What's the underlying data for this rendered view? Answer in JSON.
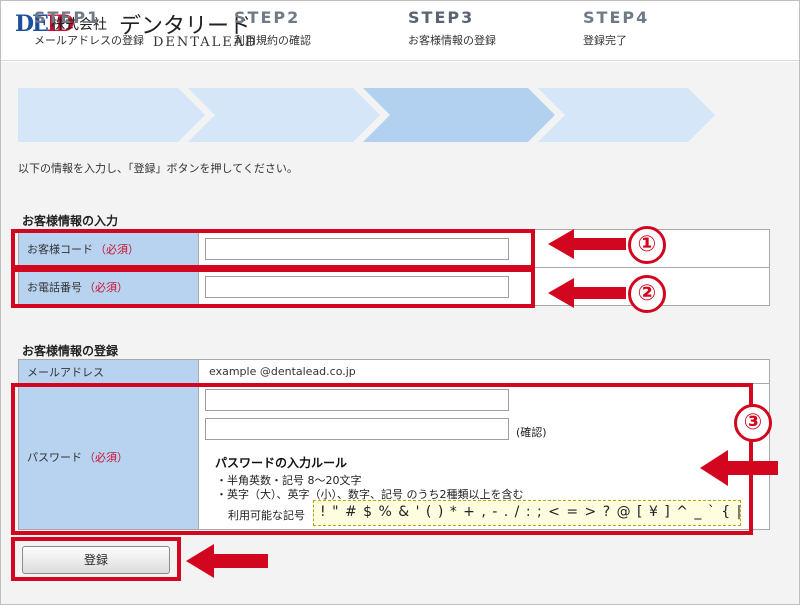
{
  "header": {
    "logo_mark_a": "DE",
    "logo_mark_b": "ID",
    "company_prefix": "株式会社",
    "company_name": "デンタリード",
    "company_en": "DENTALEAD"
  },
  "steps": [
    {
      "num": "STEP1",
      "label": "メールアドレスの登録",
      "state": "done"
    },
    {
      "num": "STEP2",
      "label": "利用規約の確認",
      "state": "done"
    },
    {
      "num": "STEP3",
      "label": "お客様情報の登録",
      "state": "current"
    },
    {
      "num": "STEP4",
      "label": "登録完了",
      "state": "todo"
    }
  ],
  "intro": "以下の情報を入力し、「登録」ボタンを押してください。",
  "section_input": {
    "title": "お客様情報の入力",
    "customer_code_label": "お客様コード",
    "customer_code_value": "",
    "phone_label": "お電話番号",
    "phone_value": "",
    "required": "（必須）"
  },
  "section_register": {
    "title": "お客様情報の登録",
    "email_label": "メールアドレス",
    "email_value": "example @dentalead.co.jp",
    "password_label": "パスワード",
    "password_value": "",
    "password_confirm_value": "",
    "confirm_label": "(確認)",
    "required": "（必須）",
    "rules_title": "パスワードの入力ルール",
    "rule_1": "・半角英数・記号 8～20文字",
    "rule_2": "・英字（大）、英字（小）、数字、記号 のうち2種類以上を含む",
    "allowed_label": "利用可能な記号",
    "allowed_chars": "! \" # $ % & ' ( ) * + , - . / : ; < = > ? @ [ ¥ ] ^ _ ` { | }"
  },
  "submit_label": "登録",
  "annotations": {
    "marker_1": "①",
    "marker_2": "②",
    "marker_3": "③",
    "accent_color": "#d3061f"
  },
  "colors": {
    "label_bg": "#b8d3f0",
    "step_done": "#d4e6f7",
    "step_current": "#b2d1f0"
  }
}
